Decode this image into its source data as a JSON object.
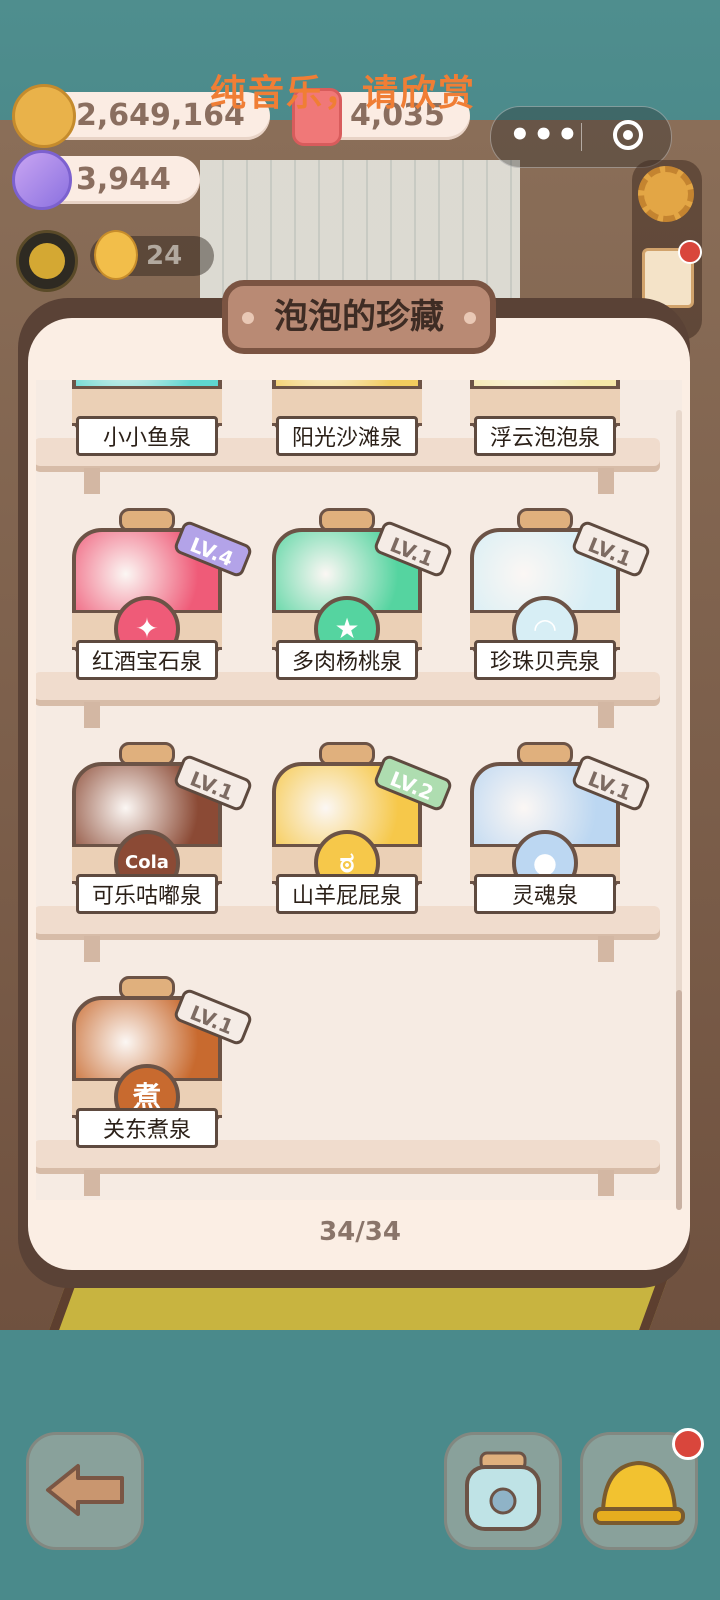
{
  "overlay": {
    "text": "纯音乐，请欣赏"
  },
  "currency": {
    "coins": "2,649,164",
    "gems": "4,035",
    "candies": "3,944",
    "chicks": "24"
  },
  "capsule": {
    "more": "•••"
  },
  "panel": {
    "title": "泡泡的珍藏",
    "page_count": "34/34"
  },
  "jars": [
    {
      "name": "小小鱼泉",
      "level": "",
      "color": "#5fd6d0"
    },
    {
      "name": "阳光沙滩泉",
      "level": "",
      "color": "#f2cc5e"
    },
    {
      "name": "浮云泡泡泉",
      "level": "",
      "color": "#f5e7a8"
    },
    {
      "name": "红酒宝石泉",
      "level": "LV.4",
      "color": "#ef5b78",
      "emblem": "✦"
    },
    {
      "name": "多肉杨桃泉",
      "level": "LV.1",
      "color": "#55d4a0",
      "emblem": "★"
    },
    {
      "name": "珍珠贝壳泉",
      "level": "LV.1",
      "color": "#d7eef5",
      "emblem": "◠"
    },
    {
      "name": "可乐咕嘟泉",
      "level": "LV.1",
      "color": "#8b4a35",
      "emblem": "Cola"
    },
    {
      "name": "山羊屁屁泉",
      "level": "LV.2",
      "color": "#f6c84a",
      "emblem": "ಠ"
    },
    {
      "name": "灵魂泉",
      "level": "LV.1",
      "color": "#bcd7f2",
      "emblem": "●"
    },
    {
      "name": "关东煮泉",
      "level": "LV.1",
      "color": "#c86a2f",
      "emblem": "煮"
    }
  ]
}
